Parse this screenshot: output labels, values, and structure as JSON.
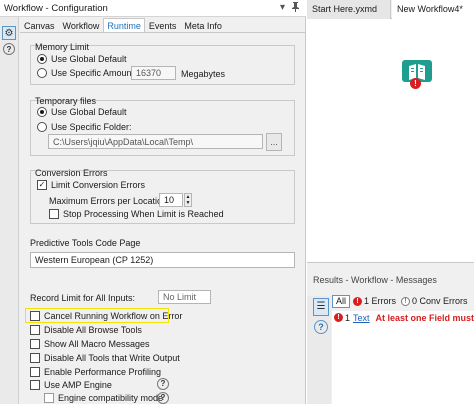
{
  "config": {
    "title": "Workflow - Configuration",
    "tabs": [
      "Canvas",
      "Workflow",
      "Runtime",
      "Events",
      "Meta Info"
    ],
    "active_tab": "Runtime",
    "memory_limit": {
      "label": "Memory Limit",
      "opt_global": "Use Global Default",
      "opt_specific": "Use Specific Amount:",
      "amount": "16370",
      "unit": "Megabytes"
    },
    "temp_files": {
      "label": "Temporary files",
      "opt_global": "Use Global Default",
      "opt_specific": "Use Specific Folder:",
      "folder": "C:\\Users\\jqiu\\AppData\\Local\\Temp\\",
      "browse": "..."
    },
    "conversion_errors": {
      "label": "Conversion Errors",
      "limit": "Limit Conversion Errors",
      "max_label": "Maximum Errors per Location:",
      "max_value": "10",
      "stop": "Stop Processing When Limit is Reached"
    },
    "predictive": {
      "label": "Predictive Tools Code Page",
      "value": "Western European (CP 1252)"
    },
    "record_limit": {
      "label": "Record Limit for All Inputs:",
      "placeholder": "No Limit"
    },
    "options": {
      "cancel_on_error": "Cancel Running Workflow on Error",
      "disable_browse": "Disable All Browse Tools",
      "show_macro": "Show All Macro Messages",
      "disable_output": "Disable All Tools that Write Output",
      "enable_profiling": "Enable Performance Profiling",
      "use_amp": "Use AMP Engine",
      "engine_compat": "Engine compatibility mode"
    }
  },
  "canvas": {
    "tabs": [
      "Start Here.yxmd",
      "New Workflow4*"
    ],
    "active_tab": "New Workflow4*"
  },
  "results": {
    "title": "Results - Workflow - Messages",
    "filter_all": "All",
    "errors": "1 Errors",
    "conv_errors": "0 Conv Errors",
    "message": {
      "badge": "1",
      "tool": "Text",
      "text": "At least one Field must be s"
    }
  },
  "icons": {
    "pin": "pin-icon",
    "dropdown": "chevron-down-icon",
    "settings": "gear-icon",
    "help": "help-icon",
    "tool": "text-input-tool-icon",
    "error": "error-icon"
  },
  "colors": {
    "accent": "#1e73be",
    "error": "#d81e1e",
    "tool_teal": "#1f9e8f",
    "highlight": "#f2e400"
  }
}
